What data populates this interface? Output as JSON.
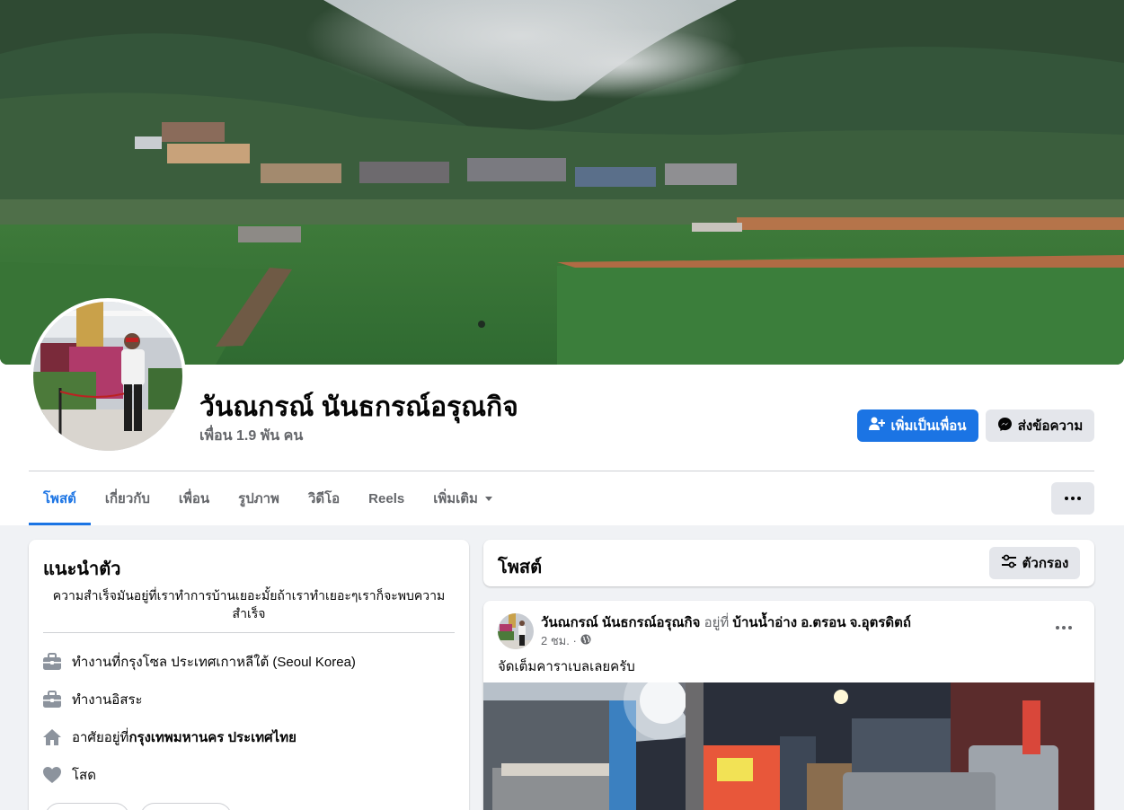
{
  "profile": {
    "name": "วันณกรณ์ นันธกรณ์อรุณกิจ",
    "friends": "เพื่อน 1.9 พัน คน"
  },
  "actions": {
    "add_friend": "เพิ่มเป็นเพื่อน",
    "message": "ส่งข้อความ"
  },
  "tabs": [
    {
      "label": "โพสต์"
    },
    {
      "label": "เกี่ยวกับ"
    },
    {
      "label": "เพื่อน"
    },
    {
      "label": "รูปภาพ"
    },
    {
      "label": "วิดีโอ"
    },
    {
      "label": "Reels"
    },
    {
      "label": "เพิ่มเติม"
    }
  ],
  "intro": {
    "title": "แนะนำตัว",
    "bio": "ความสำเร็จมันอยู่ที่เราทำการบ้านเยอะมั้ยถ้าเราทำเยอะๆเราก็จะพบความสำเร็จ",
    "items": [
      {
        "icon": "briefcase-icon",
        "prefix": "ทำงานที่ ",
        "value": "กรุงโซล ประเทศเกาหลีใต้ (Seoul Korea)"
      },
      {
        "icon": "briefcase-icon",
        "prefix": "",
        "value": "ทำงานอิสระ"
      },
      {
        "icon": "home-icon",
        "prefix": "อาศัยอยู่ที่ ",
        "value": "กรุงเทพมหานคร ประเทศไทย"
      },
      {
        "icon": "heart-icon",
        "prefix": "",
        "value": "โสด"
      }
    ]
  },
  "posts": {
    "title": "โพสต์",
    "filter": "ตัวกรอง"
  },
  "post": {
    "author": "วันณกรณ์ นันธกรณ์อรุณกิจ",
    "at": "อยู่ที่",
    "place": "บ้านน้ำอ่าง อ.ตรอน จ.อุตรดิตถ์",
    "time": "2 ชม. ·",
    "text": "จัดเต็มคาราเบลเลยครับ"
  },
  "colors": {
    "primary": "#1b74e4",
    "background": "#f0f2f5",
    "secondary_button": "#e4e6eb",
    "muted_text": "#65676b"
  }
}
